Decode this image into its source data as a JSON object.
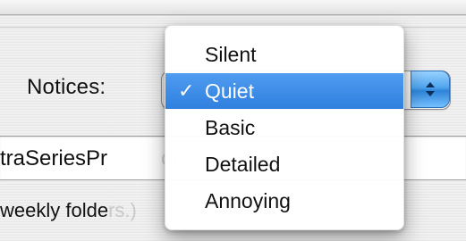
{
  "preferences": {
    "notices_label": "Notices:",
    "text_field_visible_value": "traSeriesPr",
    "text_field_covered_value": "ocessed",
    "small_text_visible": "weekly folde",
    "small_text_covered": "rs.)"
  },
  "popup": {
    "selected_value": "Quiet"
  },
  "menu": {
    "items": [
      {
        "label": "Silent",
        "checked": false
      },
      {
        "label": "Quiet",
        "checked": true
      },
      {
        "label": "Basic",
        "checked": false
      },
      {
        "label": "Detailed",
        "checked": false
      },
      {
        "label": "Annoying",
        "checked": false
      }
    ],
    "check_glyph": "✓"
  },
  "colors": {
    "menu_highlight": "#2f7fdf",
    "popup_arrow": "#2d84d8"
  }
}
